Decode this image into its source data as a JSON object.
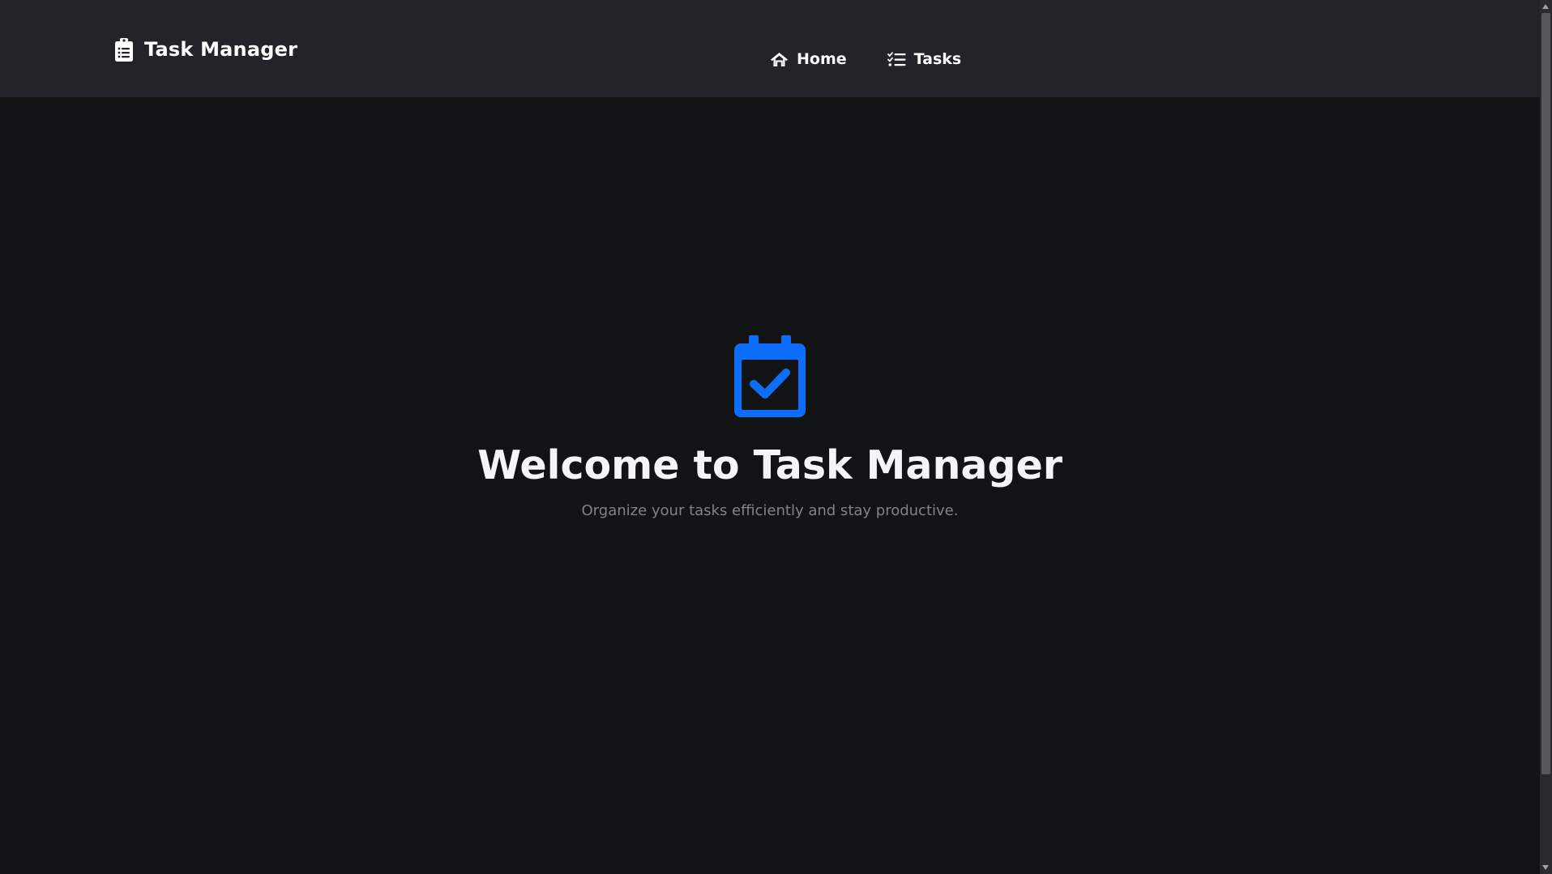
{
  "navbar": {
    "brand": {
      "icon": "clipboard-list-icon",
      "label": "Task Manager"
    },
    "links": [
      {
        "icon": "home-icon",
        "label": "Home"
      },
      {
        "icon": "tasks-list-icon",
        "label": "Tasks"
      }
    ]
  },
  "hero": {
    "icon": "calendar-check-icon",
    "title": "Welcome to Task Manager",
    "subtitle": "Organize your tasks efficiently and stay productive."
  },
  "colors": {
    "navbar_bg": "#212429",
    "page_bg": "#121314",
    "accent": "#0d6efd",
    "text_primary": "#f4f5f6",
    "text_muted": "#7d848c"
  }
}
